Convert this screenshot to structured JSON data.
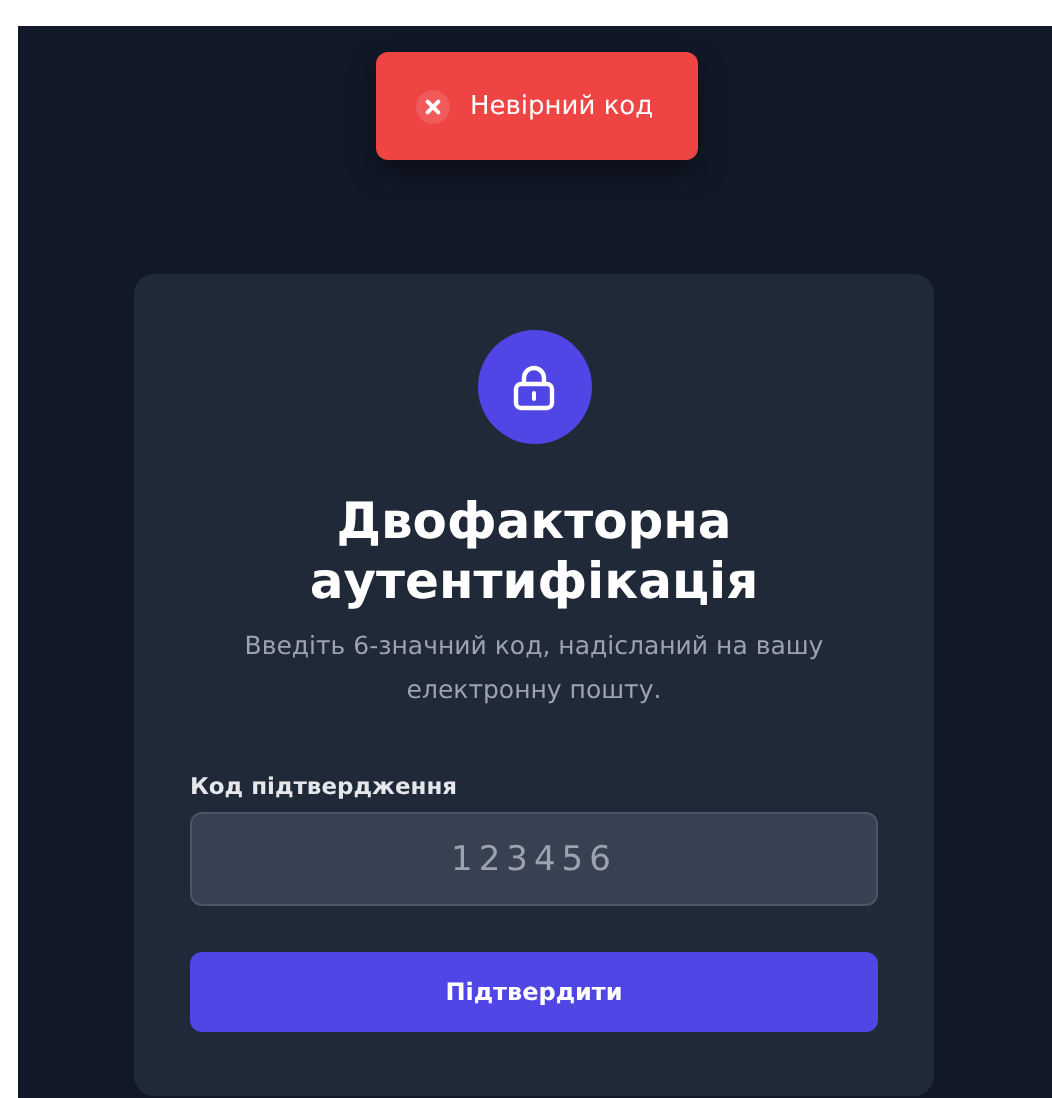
{
  "toast": {
    "kind": "error",
    "message": "Невірний код"
  },
  "card": {
    "title": "Двофакторна аутентифікація",
    "subtitle": "Введіть 6-значний код, надісланий на вашу електронну пошту.",
    "field": {
      "label": "Код підтвердження",
      "placeholder": "123456"
    },
    "button": "Підтвердити"
  }
}
